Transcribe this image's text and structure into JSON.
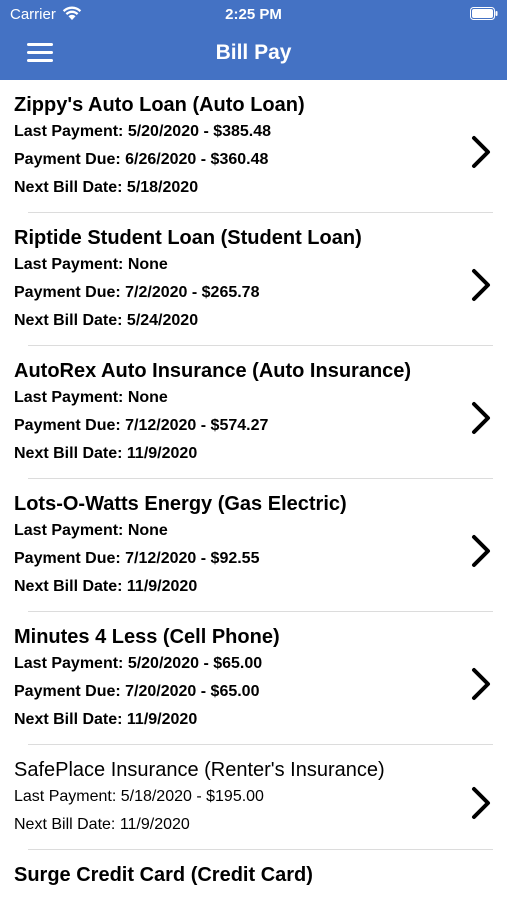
{
  "status_bar": {
    "carrier": "Carrier",
    "time": "2:25 PM"
  },
  "nav": {
    "title": "Bill Pay",
    "menu_icon": "hamburger-menu-icon"
  },
  "colors": {
    "header_bg": "#4472c4",
    "separator": "#dcdcdc"
  },
  "bills": [
    {
      "title": "Zippy's Auto Loan (Auto Loan)",
      "lines": [
        "Last Payment: 5/20/2020 - $385.48",
        "Payment Due: 6/26/2020 - $360.48",
        "Next Bill Date: 5/18/2020"
      ]
    },
    {
      "title": "Riptide Student Loan (Student Loan)",
      "lines": [
        "Last Payment: None",
        "Payment Due: 7/2/2020 - $265.78",
        "Next Bill Date: 5/24/2020"
      ]
    },
    {
      "title": "AutoRex Auto Insurance (Auto Insurance)",
      "lines": [
        "Last Payment: None",
        "Payment Due: 7/12/2020 - $574.27",
        "Next Bill Date: 11/9/2020"
      ]
    },
    {
      "title": "Lots-O-Watts Energy (Gas Electric)",
      "lines": [
        "Last Payment: None",
        "Payment Due: 7/12/2020 - $92.55",
        "Next Bill Date: 11/9/2020"
      ]
    },
    {
      "title": "Minutes 4 Less (Cell Phone)",
      "lines": [
        "Last Payment: 5/20/2020 - $65.00",
        "Payment Due: 7/20/2020 - $65.00",
        "Next Bill Date: 11/9/2020"
      ]
    },
    {
      "title": "SafePlace Insurance (Renter's Insurance)",
      "lines": [
        "Last Payment: 5/18/2020 - $195.00",
        "Next Bill Date: 11/9/2020"
      ]
    },
    {
      "title": "Surge Credit Card (Credit Card)",
      "lines": []
    }
  ]
}
